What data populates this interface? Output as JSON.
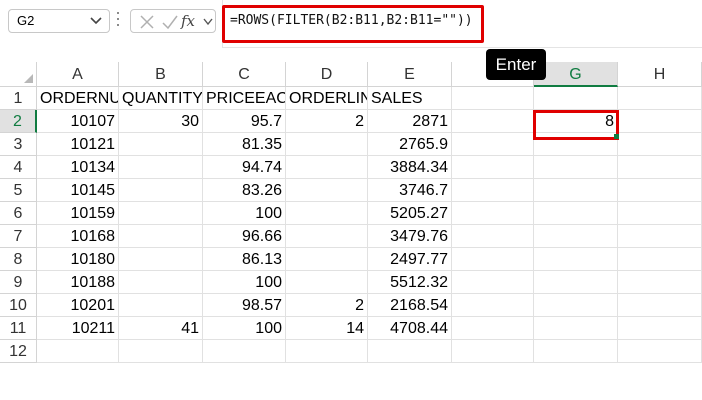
{
  "formula_bar": {
    "name_box": "G2",
    "fx_label": "fx",
    "formula": "=ROWS(FILTER(B2:B11,B2:B11=\"\"))"
  },
  "annotation": {
    "enter_label": "Enter"
  },
  "columns": [
    "A",
    "B",
    "C",
    "D",
    "E",
    "",
    "G",
    "H"
  ],
  "rows": [
    {
      "num": "1",
      "A": "ORDERNU",
      "B": "QUANTITY",
      "C": "PRICEEACI",
      "D": "ORDERLIN",
      "E": "SALES",
      "G": ""
    },
    {
      "num": "2",
      "A": "10107",
      "B": "30",
      "C": "95.7",
      "D": "2",
      "E": "2871",
      "G": "8"
    },
    {
      "num": "3",
      "A": "10121",
      "B": "",
      "C": "81.35",
      "D": "",
      "E": "2765.9",
      "G": ""
    },
    {
      "num": "4",
      "A": "10134",
      "B": "",
      "C": "94.74",
      "D": "",
      "E": "3884.34",
      "G": ""
    },
    {
      "num": "5",
      "A": "10145",
      "B": "",
      "C": "83.26",
      "D": "",
      "E": "3746.7",
      "G": ""
    },
    {
      "num": "6",
      "A": "10159",
      "B": "",
      "C": "100",
      "D": "",
      "E": "5205.27",
      "G": ""
    },
    {
      "num": "7",
      "A": "10168",
      "B": "",
      "C": "96.66",
      "D": "",
      "E": "3479.76",
      "G": ""
    },
    {
      "num": "8",
      "A": "10180",
      "B": "",
      "C": "86.13",
      "D": "",
      "E": "2497.77",
      "G": ""
    },
    {
      "num": "9",
      "A": "10188",
      "B": "",
      "C": "100",
      "D": "",
      "E": "5512.32",
      "G": ""
    },
    {
      "num": "10",
      "A": "10201",
      "B": "",
      "C": "98.57",
      "D": "2",
      "E": "2168.54",
      "G": ""
    },
    {
      "num": "11",
      "A": "10211",
      "B": "41",
      "C": "100",
      "D": "14",
      "E": "4708.44",
      "G": ""
    },
    {
      "num": "12",
      "A": "",
      "B": "",
      "C": "",
      "D": "",
      "E": "",
      "G": ""
    }
  ],
  "selected_cell": "G2",
  "colors": {
    "highlight": "#e00000",
    "excel_green": "#107c41"
  },
  "icons": [
    "chevron-down-icon",
    "cancel-icon",
    "enter-check-icon",
    "insert-function-icon"
  ]
}
